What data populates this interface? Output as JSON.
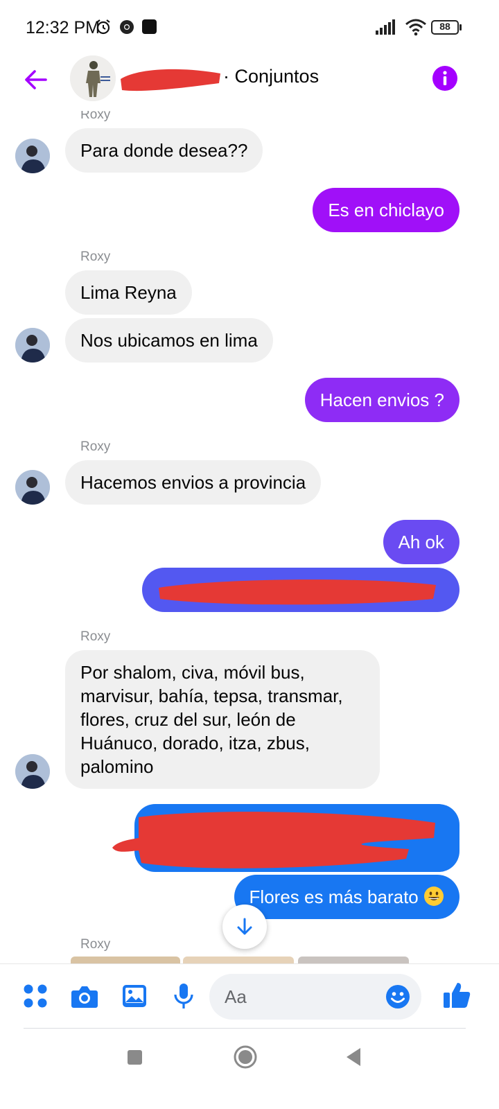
{
  "status_bar": {
    "time": "12:32 PM",
    "battery": "88",
    "icons": [
      "alarm-icon",
      "chrome-icon",
      "notification-icon",
      "signal-icon",
      "wifi-icon",
      "battery-icon"
    ]
  },
  "header": {
    "title": "· Conjuntos",
    "icons": [
      "back-arrow-icon",
      "info-icon"
    ],
    "accent_color": "#a400ff"
  },
  "messages": [
    {
      "sender": "Roxy",
      "direction": "in",
      "text": "Para donde desea??"
    },
    {
      "direction": "out",
      "text": "Es en chiclayo",
      "color": "#a010f8"
    },
    {
      "sender": "Roxy",
      "direction": "in",
      "text": "Lima Reyna"
    },
    {
      "direction": "in",
      "text": "Nos ubicamos en lima"
    },
    {
      "direction": "out",
      "text": "Hacen envios ?",
      "color": "#8e2cf5"
    },
    {
      "sender": "Roxy",
      "direction": "in",
      "text": "Hacemos envios a provincia"
    },
    {
      "direction": "out",
      "text": "Ah ok",
      "color": "#6a4bf2"
    },
    {
      "direction": "out",
      "text": "[redacted]",
      "color": "#5358f1"
    },
    {
      "sender": "Roxy",
      "direction": "in",
      "text": "Por shalom, civa, móvil bus, marvisur, bahía, tepsa, transmar, flores, cruz del sur, león de Huánuco, dorado, itza, zbus, palomino"
    },
    {
      "direction": "out",
      "text": "[redacted]",
      "color": "#1877f2"
    },
    {
      "direction": "out",
      "text": "Flores es más barato",
      "color": "#1877f2",
      "emoji": "grinning-face-emoji"
    },
    {
      "sender": "Roxy",
      "direction": "in",
      "text": ""
    }
  ],
  "composer": {
    "placeholder": "Aa",
    "icons": [
      "menu-dots-icon",
      "camera-icon",
      "gallery-icon",
      "microphone-icon",
      "emoji-icon",
      "thumbs-up-icon"
    ],
    "accent_color": "#1877f2"
  },
  "navigation": {
    "icons": [
      "recents-icon",
      "home-icon",
      "back-icon"
    ]
  }
}
